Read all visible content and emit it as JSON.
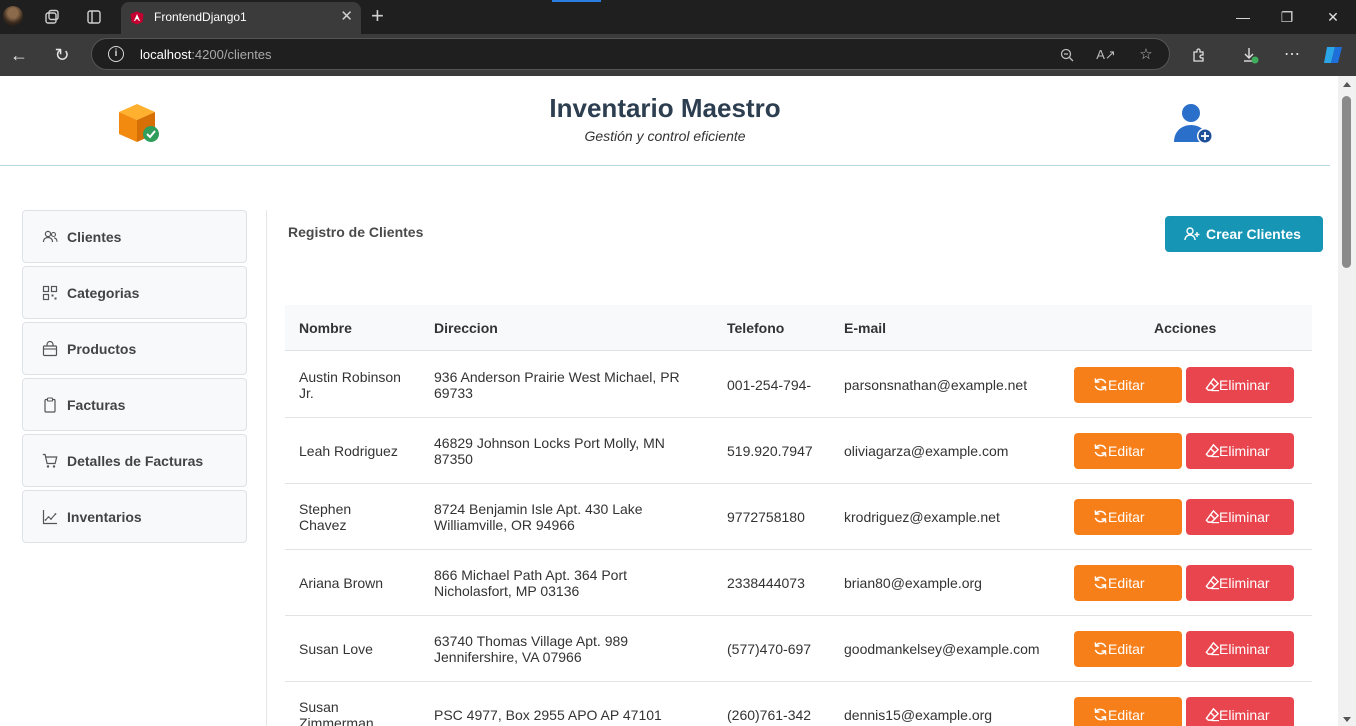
{
  "browser": {
    "tab_title": "FrontendDjango1",
    "url_host": "localhost",
    "url_rest": ":4200/clientes",
    "tab_close": "✕",
    "new_tab": "+"
  },
  "header": {
    "title": "Inventario Maestro",
    "subtitle": "Gestión y control eficiente"
  },
  "sidebar": {
    "items": [
      {
        "label": "Clientes",
        "icon": "users-icon"
      },
      {
        "label": "Categorias",
        "icon": "grid-icon"
      },
      {
        "label": "Productos",
        "icon": "bag-icon"
      },
      {
        "label": "Facturas",
        "icon": "clipboard-icon"
      },
      {
        "label": "Detalles de Facturas",
        "icon": "cart-icon"
      },
      {
        "label": "Inventarios",
        "icon": "chart-icon"
      }
    ]
  },
  "main": {
    "section_title": "Registro de Clientes",
    "create_button": "Crear Clientes",
    "columns": [
      "Nombre",
      "Direccion",
      "Telefono",
      "E-mail",
      "Acciones"
    ],
    "edit_label": "Editar",
    "delete_label": "Eliminar",
    "rows": [
      {
        "name": [
          "Austin Robinson",
          "Jr."
        ],
        "address": [
          "936 Anderson Prairie West Michael, PR",
          "69733"
        ],
        "phone": "001-254-794-",
        "email": "parsonsnathan@example.net"
      },
      {
        "name": [
          "Leah Rodriguez"
        ],
        "address": [
          "46829 Johnson Locks Port Molly, MN",
          "87350"
        ],
        "phone": "519.920.7947",
        "email": "oliviagarza@example.com"
      },
      {
        "name": [
          "Stephen",
          "Chavez"
        ],
        "address": [
          "8724 Benjamin Isle Apt. 430 Lake",
          "Williamville, OR 94966"
        ],
        "phone": "9772758180",
        "email": "krodriguez@example.net"
      },
      {
        "name": [
          "Ariana Brown"
        ],
        "address": [
          "866 Michael Path Apt. 364 Port",
          "Nicholasfort, MP 03136"
        ],
        "phone": "2338444073",
        "email": "brian80@example.org"
      },
      {
        "name": [
          "Susan Love"
        ],
        "address": [
          "63740 Thomas Village Apt. 989",
          "Jennifershire, VA 07966"
        ],
        "phone": "(577)470-697",
        "email": "goodmankelsey@example.com"
      },
      {
        "name": [
          "Susan",
          "Zimmerman"
        ],
        "address": [
          "PSC 4977, Box 2955 APO AP 47101"
        ],
        "phone": "(260)761-342",
        "email": "dennis15@example.org"
      }
    ]
  },
  "colors": {
    "primary": "#1795b5",
    "edit": "#f77f1a",
    "delete": "#e8454e",
    "title": "#2c3e50"
  }
}
